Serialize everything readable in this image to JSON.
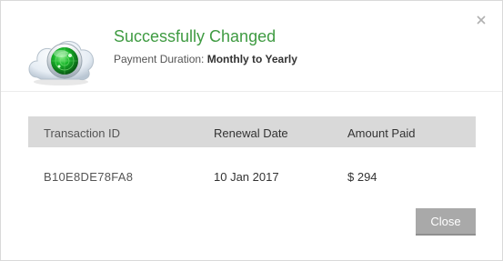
{
  "dialog": {
    "title": "Successfully Changed",
    "subtitle_label": "Payment Duration:",
    "subtitle_value": "Monthly to Yearly",
    "close_icon": "close-x-icon",
    "status_icon": "cloud-radar-icon",
    "accent_color": "#3f9b42"
  },
  "table": {
    "headers": [
      "Transaction ID",
      "Renewal Date",
      "Amount Paid"
    ],
    "rows": [
      [
        "B10E8DE78FA8",
        "10 Jan 2017",
        "$ 294"
      ]
    ]
  },
  "footer": {
    "close_label": "Close"
  }
}
